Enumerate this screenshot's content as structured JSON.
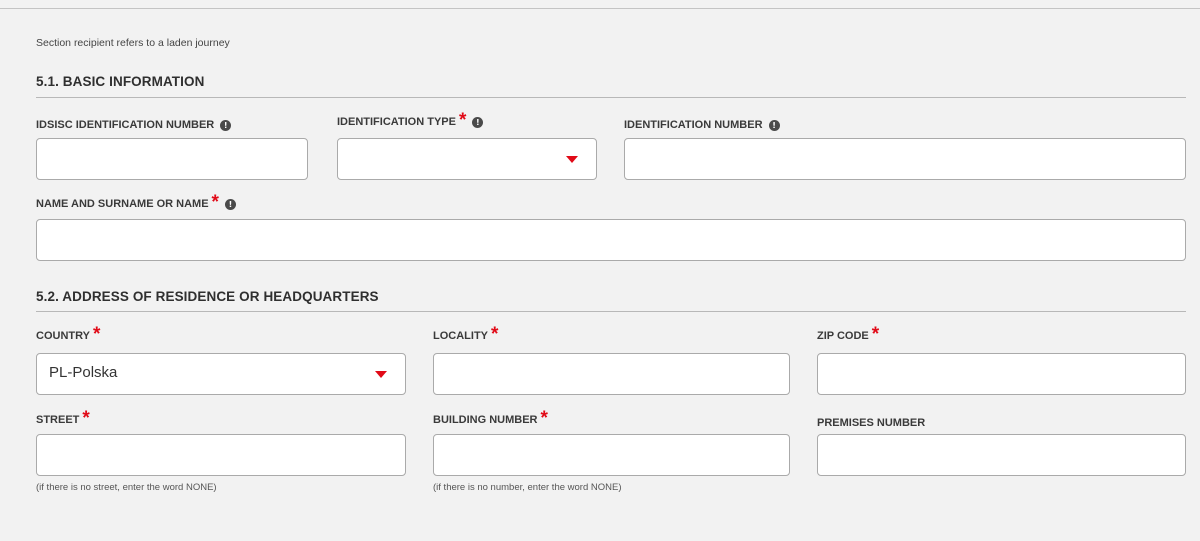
{
  "intro_text": "Section recipient refers to a laden journey",
  "basic": {
    "title": "5.1. BASIC INFORMATION",
    "idsisc_label": "IDSISC IDENTIFICATION NUMBER",
    "idsisc_value": "",
    "id_type_label": "IDENTIFICATION TYPE",
    "id_type_value": "",
    "id_number_label": "IDENTIFICATION NUMBER",
    "id_number_value": "",
    "name_label": "NAME AND SURNAME OR NAME",
    "name_value": ""
  },
  "address": {
    "title": "5.2. ADDRESS OF RESIDENCE OR HEADQUARTERS",
    "country_label": "COUNTRY",
    "country_value": "PL-Polska",
    "locality_label": "LOCALITY",
    "locality_value": "",
    "zip_label": "ZIP CODE",
    "zip_value": "",
    "street_label": "STREET",
    "street_value": "",
    "street_hint": "(if there is no street, enter the word NONE)",
    "building_label": "BUILDING NUMBER",
    "building_value": "",
    "building_hint": "(if there is no number, enter the word NONE)",
    "premises_label": "PREMISES NUMBER",
    "premises_value": ""
  },
  "required_marker": "*",
  "info_icon_glyph": "!",
  "colors": {
    "required": "#e10a17",
    "background": "#f2f2f2",
    "field_border": "#aaaaaa"
  }
}
